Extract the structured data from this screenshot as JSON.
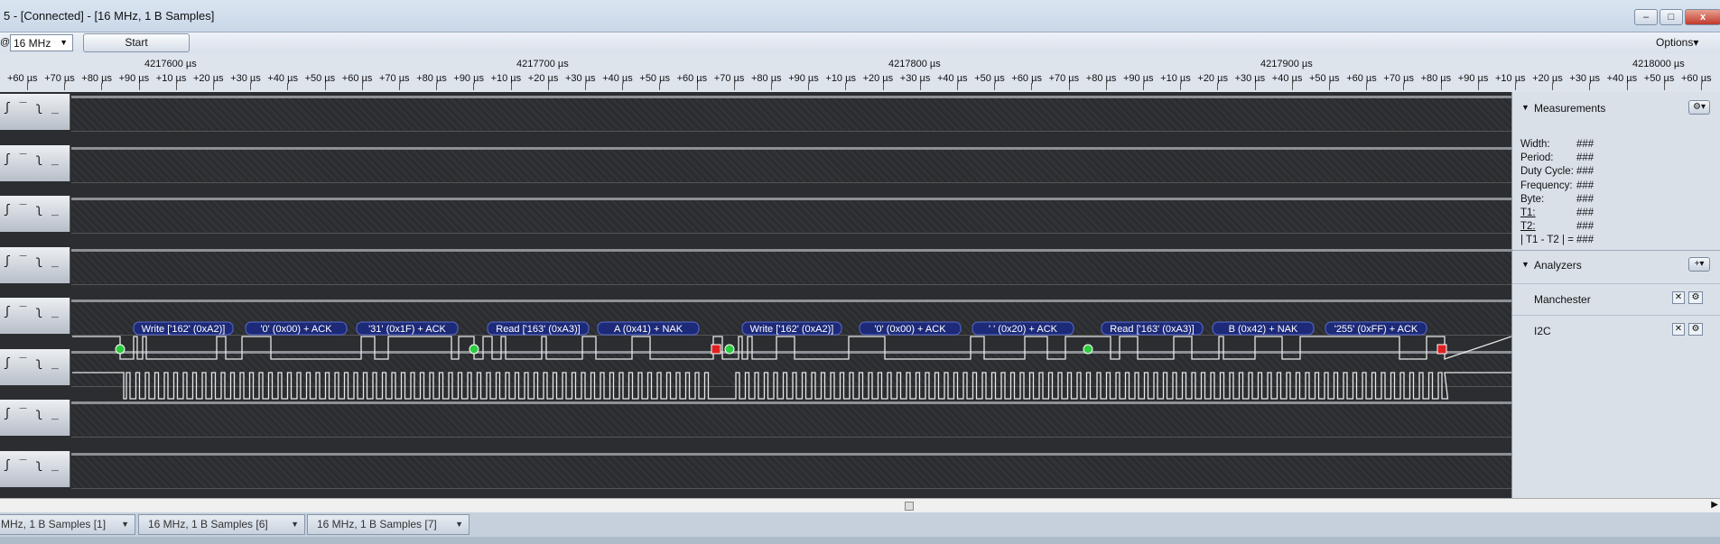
{
  "window": {
    "title": "5 - [Connected] - [16 MHz, 1 B Samples]",
    "minimize_label": "–",
    "maximize_label": "□",
    "close_label": "x"
  },
  "toolbar": {
    "at_label": "@",
    "sample_rate": "16 MHz",
    "start_label": "Start",
    "options_label": "Options▾"
  },
  "ruler": {
    "majors": [
      "4217600 µs",
      "4217700 µs",
      "4217800 µs",
      "4217900 µs",
      "4218000 µs"
    ],
    "minors": [
      "+60 µs",
      "+70 µs",
      "+80 µs",
      "+90 µs",
      "+10 µs",
      "+20 µs",
      "+30 µs",
      "+40 µs",
      "+50 µs",
      "+60 µs",
      "+70 µs",
      "+80 µs",
      "+90 µs",
      "+10 µs",
      "+20 µs",
      "+30 µs",
      "+40 µs",
      "+50 µs",
      "+60 µs",
      "+70 µs",
      "+80 µs",
      "+90 µs",
      "+10 µs",
      "+20 µs",
      "+30 µs",
      "+40 µs",
      "+50 µs",
      "+60 µs",
      "+70 µs",
      "+80 µs",
      "+90 µs",
      "+10 µs",
      "+20 µs",
      "+30 µs",
      "+40 µs",
      "+50 µs",
      "+60 µs",
      "+70 µs",
      "+80 µs",
      "+90 µs",
      "+10 µs",
      "+20 µs",
      "+30 µs",
      "+40 µs",
      "+50 µs",
      "+60 µs",
      "+70 µs",
      "+80 µs",
      "+10 µs"
    ]
  },
  "channels": {
    "handle_glyph": "ʃ ‾ ʅ _",
    "count": 8
  },
  "i2c_frames": [
    "Write ['162' (0xA2)]",
    "'0' (0x00) + ACK",
    "'31' (0x1F) + ACK",
    "Read ['163' (0xA3)]",
    "A (0x41) + NAK",
    "Write ['162' (0xA2)]",
    "'0' (0x00) + ACK",
    "' ' (0x20) + ACK",
    "Read ['163' (0xA3)]",
    "B (0x42) + NAK",
    "'255' (0xFF) + ACK"
  ],
  "measurements": {
    "header": "Measurements",
    "gear_icon": "⚙▾",
    "rows": [
      {
        "label": "Width:",
        "value": "###"
      },
      {
        "label": "Period:",
        "value": "###"
      },
      {
        "label": "Duty Cycle:",
        "value": "###"
      },
      {
        "label": "Frequency:",
        "value": "###"
      },
      {
        "label": "Byte:",
        "value": "###"
      },
      {
        "label": "T1:",
        "value": "###"
      },
      {
        "label": "T2:",
        "value": "###"
      },
      {
        "label": "| T1 - T2 | =",
        "value": "###"
      }
    ]
  },
  "analyzers": {
    "header": "Analyzers",
    "add_icon": "+▾",
    "items": [
      {
        "label": "Manchester"
      },
      {
        "label": "I2C"
      }
    ]
  },
  "tabs": [
    {
      "label": "MHz, 1 B Samples [1]"
    },
    {
      "label": "16 MHz, 1 B Samples [6]"
    },
    {
      "label": "16 MHz, 1 B Samples [7]"
    }
  ],
  "colors": {
    "frame_fill": "#1d2a78",
    "wave": "#e8e8e8",
    "start_marker": "#2ecc40",
    "stop_marker": "#e02020"
  }
}
